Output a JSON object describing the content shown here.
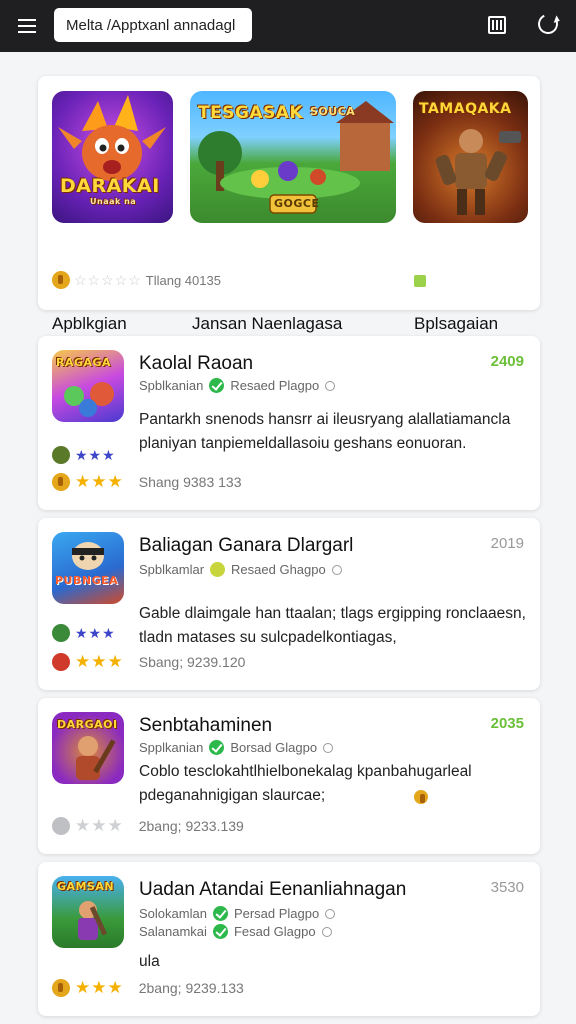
{
  "browser": {
    "url": "Melta /Apptxanl annadagl",
    "menu_icon": "hamburger-menu-icon",
    "reader_icon": "book-icon",
    "reload_icon": "reload-icon"
  },
  "featured": {
    "items": [
      {
        "art_text": "DARAKAI",
        "art_sub": "Unaak na",
        "title": "Apblkgian"
      },
      {
        "art_text": "TESGASAK",
        "art_text_2": "SOUCA",
        "art_sub": "GOGCE",
        "title": "Jansan Naenlagasa"
      },
      {
        "art_text": "TAMAQAKA",
        "title": "Bplsagaian"
      }
    ],
    "rating_text": "Tllang 40135"
  },
  "list": [
    {
      "icon_art": "RAGAGA",
      "title": "Kaolal Raoan",
      "year": "2409",
      "year_color": "#6cbf3a",
      "publishers": [
        {
          "name": "Spblkanian",
          "badge": "check",
          "dev": "Resaed Plagpo"
        }
      ],
      "description": "Pantarkh snenods hansrr ai ileusryang alallatiamancla planiyan tanpiemeldallasoiu geshans eonuoran.",
      "star_row": "blue",
      "rating": "Shang 9383 133"
    },
    {
      "icon_art": "PUBNGEA",
      "title": "Baliagan Ganara Dlargarl",
      "year": "2019",
      "year_color": "#999999",
      "publishers": [
        {
          "name": "Spblkamlar",
          "badge": "smiley",
          "dev": "Resaed Ghagpo"
        }
      ],
      "description": "Gable dlaimgale han ttaalan; tlags ergipping ronclaaesn, tladn matases su sulcpadelkontiagas,",
      "star_row": "blue",
      "rating": "Sbang; 9239.120"
    },
    {
      "icon_art": "DARGAOI",
      "title": "Senbtahaminen",
      "year": "2035",
      "year_color": "#6cbf3a",
      "publishers": [
        {
          "name": "Spplkanian",
          "badge": "check",
          "dev": "Borsad Glagpo"
        }
      ],
      "description": "Coblo tesclokahtlhielbonekalag kpanbahugarleal pdeganahnigigan slaurcae;",
      "star_row": "none",
      "rating": "2bang; 9233.139"
    },
    {
      "icon_art": "GAMSAN",
      "title": "Uadan Atandai Eenanliahnagan",
      "year": "3530",
      "year_color": "#999999",
      "publishers": [
        {
          "name": "Solokamlan",
          "badge": "check",
          "dev": "Persad Plagpo"
        },
        {
          "name": "Salanamkai",
          "badge": "check",
          "dev": "Fesad Glagpo"
        }
      ],
      "description": "ula",
      "star_row": "none",
      "rating": "2bang; 9239.133"
    }
  ]
}
